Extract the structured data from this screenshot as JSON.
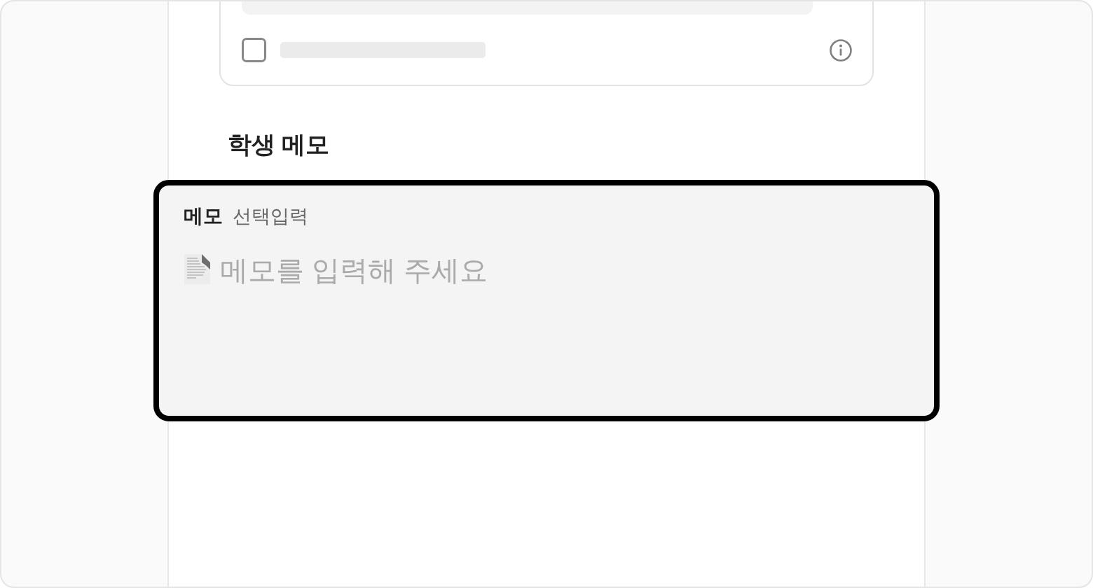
{
  "top_card": {
    "checkbox": {
      "checked": false
    }
  },
  "student_memo": {
    "title": "학생 메모",
    "field": {
      "label": "메모",
      "tag": "선택입력",
      "placeholder": "메모를 입력해 주세요",
      "highlighted": true
    }
  }
}
